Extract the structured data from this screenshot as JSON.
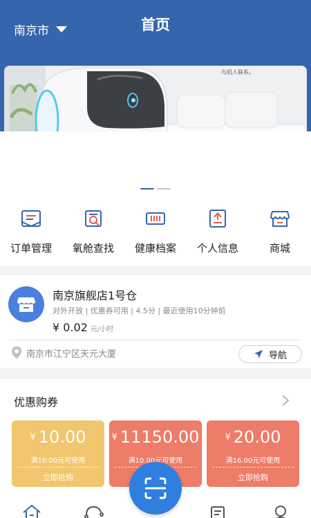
{
  "header": {
    "city": "南京市",
    "title": "首页"
  },
  "banner": {
    "caption": "与机人联系。",
    "slides": 2,
    "active_slide": 1
  },
  "quick_nav": [
    {
      "label": "订单管理",
      "icon": "order-mail-icon"
    },
    {
      "label": "氧舱查找",
      "icon": "search-doc-icon"
    },
    {
      "label": "健康档案",
      "icon": "health-barcode-icon"
    },
    {
      "label": "个人信息",
      "icon": "profile-upload-icon"
    },
    {
      "label": "商城",
      "icon": "store-icon"
    }
  ],
  "store": {
    "name": "南京旗舰店1号仓",
    "tags": "对外开放 | 优惠券可用 | 4.5分 | 最近使用10分钟前",
    "price": "¥ 0.02",
    "price_unit": "元/小时",
    "address": "南京市江宁区天元大厦",
    "nav_label": "导航"
  },
  "coupons": {
    "title": "优惠购券",
    "items": [
      {
        "symbol": "¥",
        "amount": "10.00",
        "condition": "满10.00元可使用",
        "action": "立即抢购"
      },
      {
        "symbol": "¥",
        "amount": "11150.00",
        "condition": "满10.00元可使用",
        "action": ""
      },
      {
        "symbol": "¥",
        "amount": "20.00",
        "condition": "满16.00元可使用",
        "action": "立即抢购"
      }
    ]
  },
  "colors": {
    "primary": "#3565ad",
    "coupon_yellow": "#f2c66f",
    "coupon_red": "#ed7c68",
    "fab": "#2e7fe0"
  }
}
